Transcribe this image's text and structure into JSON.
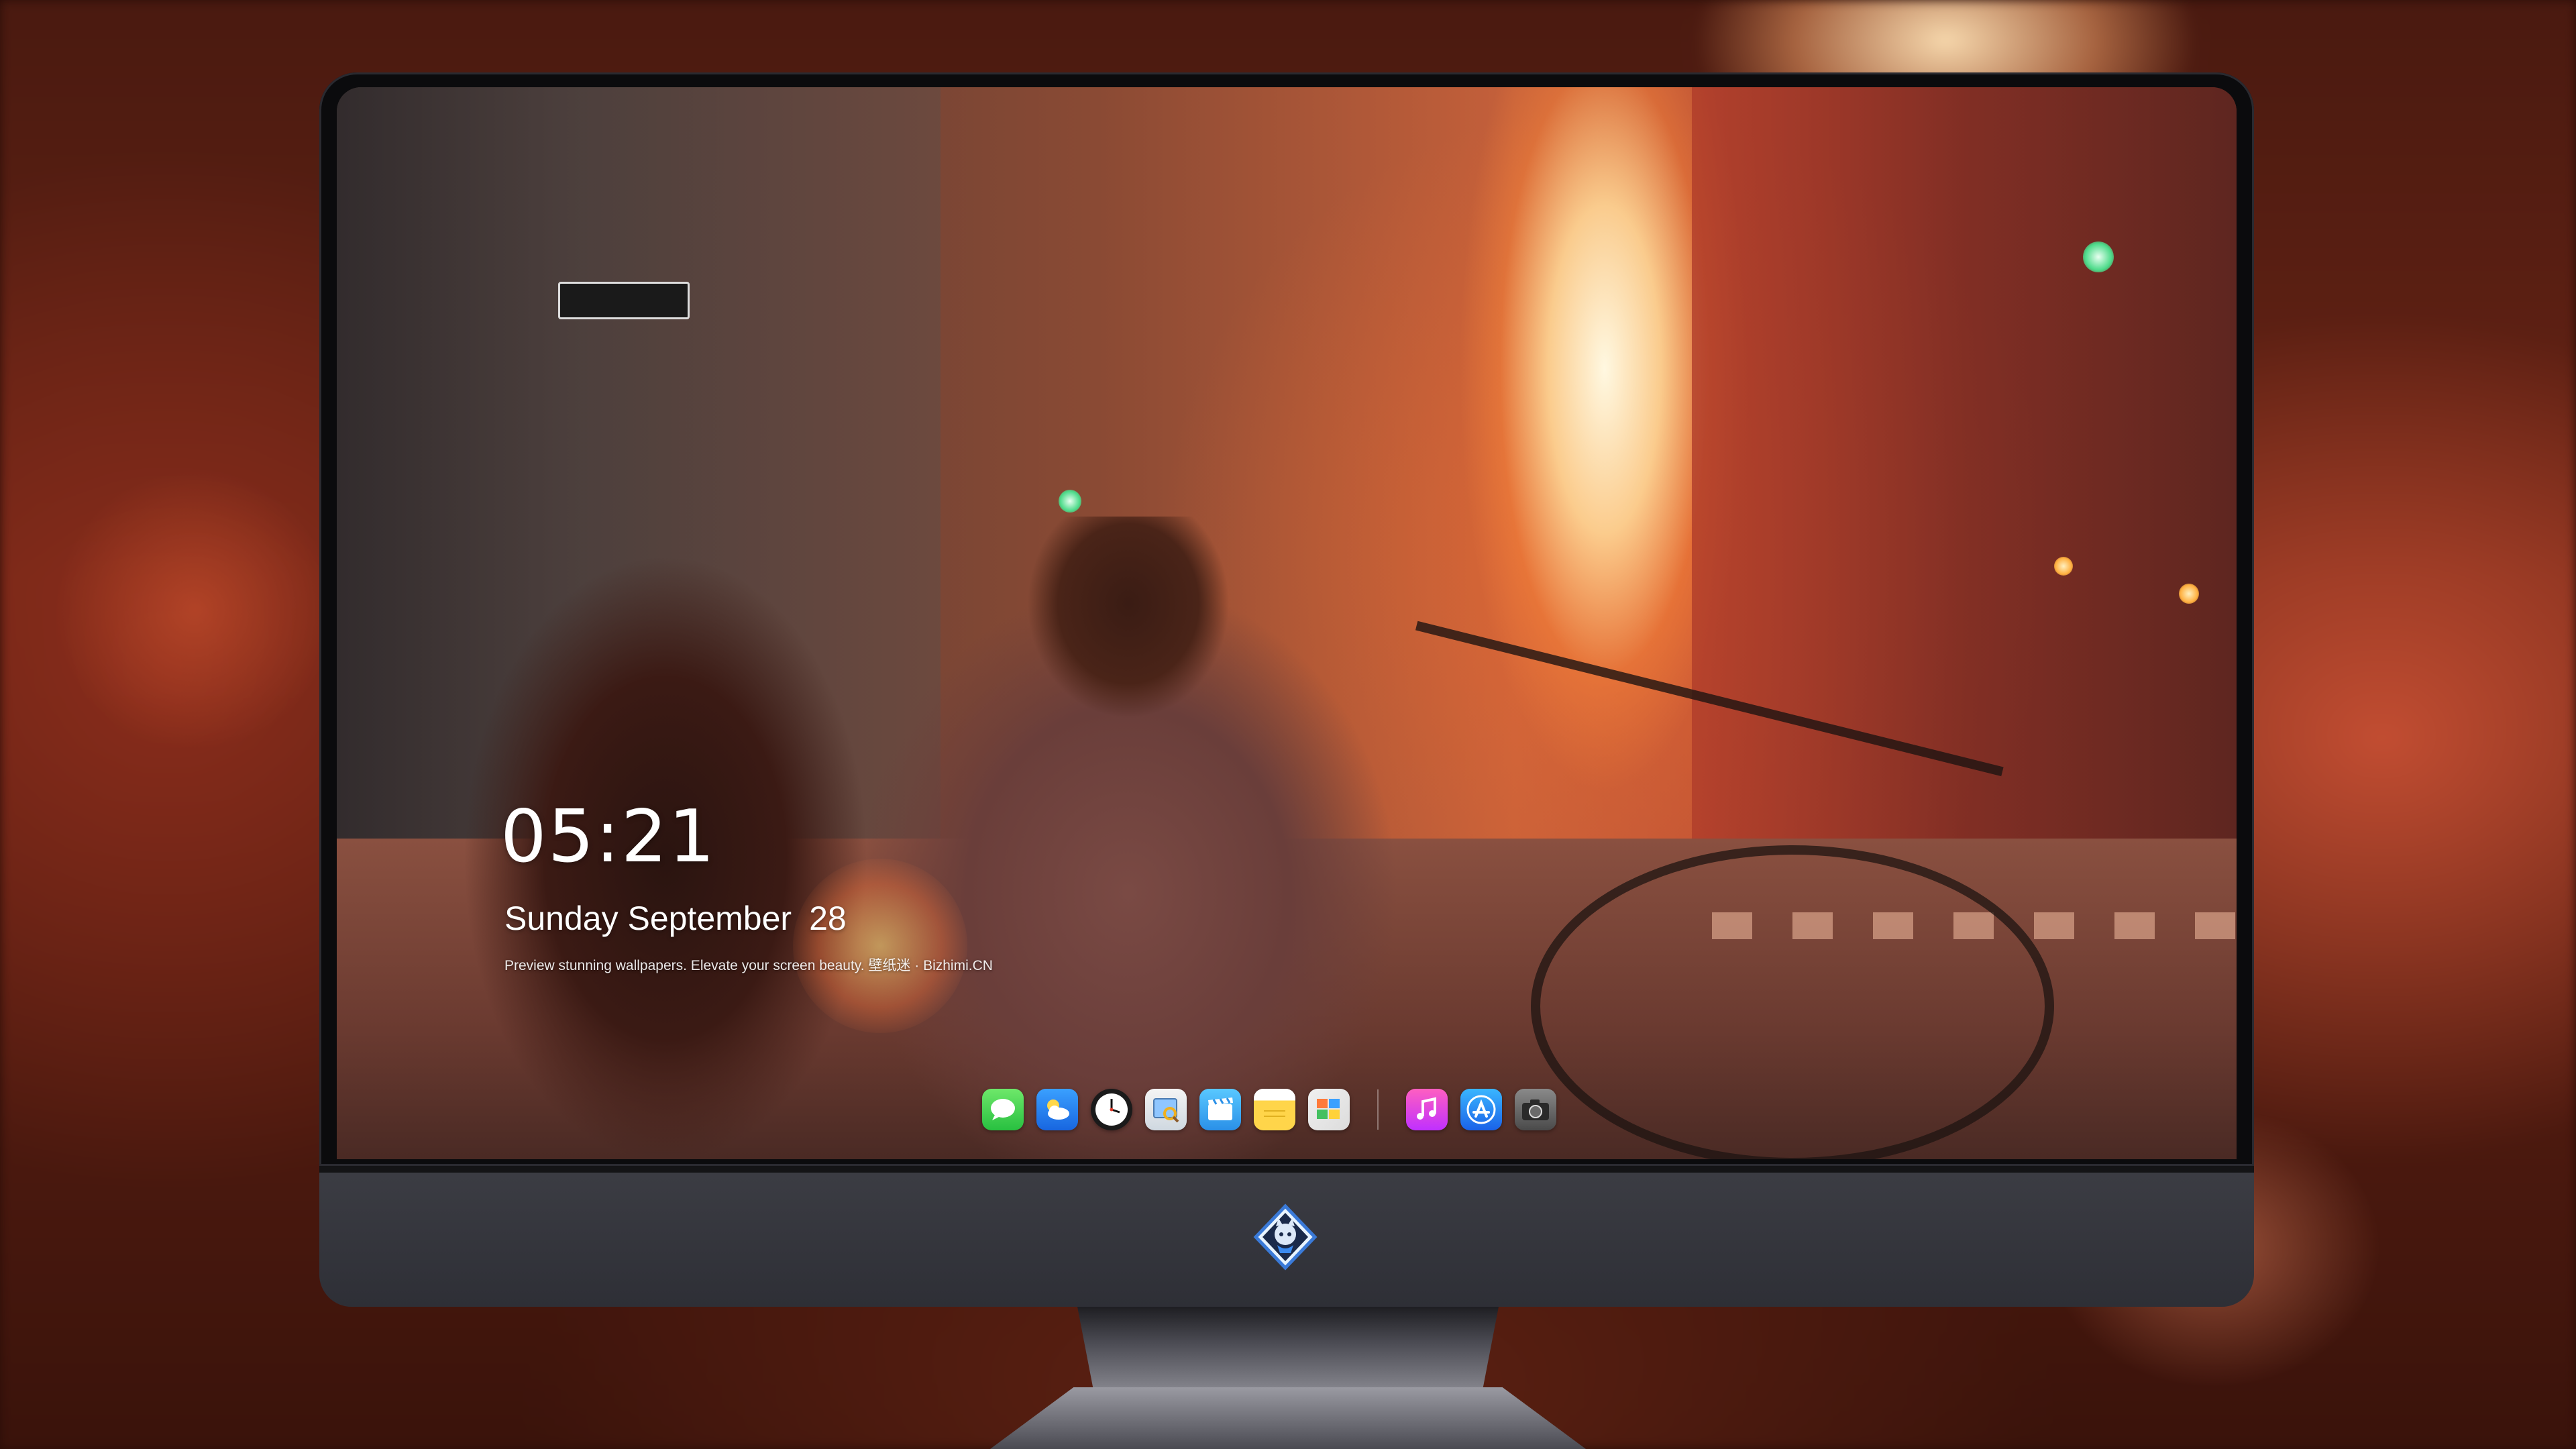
{
  "lock_screen": {
    "time": "05:21",
    "weekday_month": "Sunday September",
    "day": "28",
    "caption": "Preview stunning wallpapers. Elevate your screen beauty. 壁纸迷 · Bizhimi.CN"
  },
  "dock": {
    "apps": [
      {
        "name": "messages-icon",
        "color": "#34c759"
      },
      {
        "name": "weather-icon",
        "color": "#1e7cf2"
      },
      {
        "name": "clock-icon",
        "color": "#1a1a1a"
      },
      {
        "name": "preview-icon",
        "color": "#e6ecf2"
      },
      {
        "name": "clips-icon",
        "color": "#3aaeff"
      },
      {
        "name": "notes-icon",
        "color": "#ffd54a"
      },
      {
        "name": "photos-icon",
        "color": "#e8e8e8"
      }
    ],
    "apps_right": [
      {
        "name": "music-icon",
        "color": "#e040c8"
      },
      {
        "name": "app-store-icon",
        "color": "#1e88f0"
      },
      {
        "name": "camera-icon",
        "color": "#6a6a6a"
      }
    ]
  },
  "monitor": {
    "logo": "mascot-logo-icon"
  }
}
